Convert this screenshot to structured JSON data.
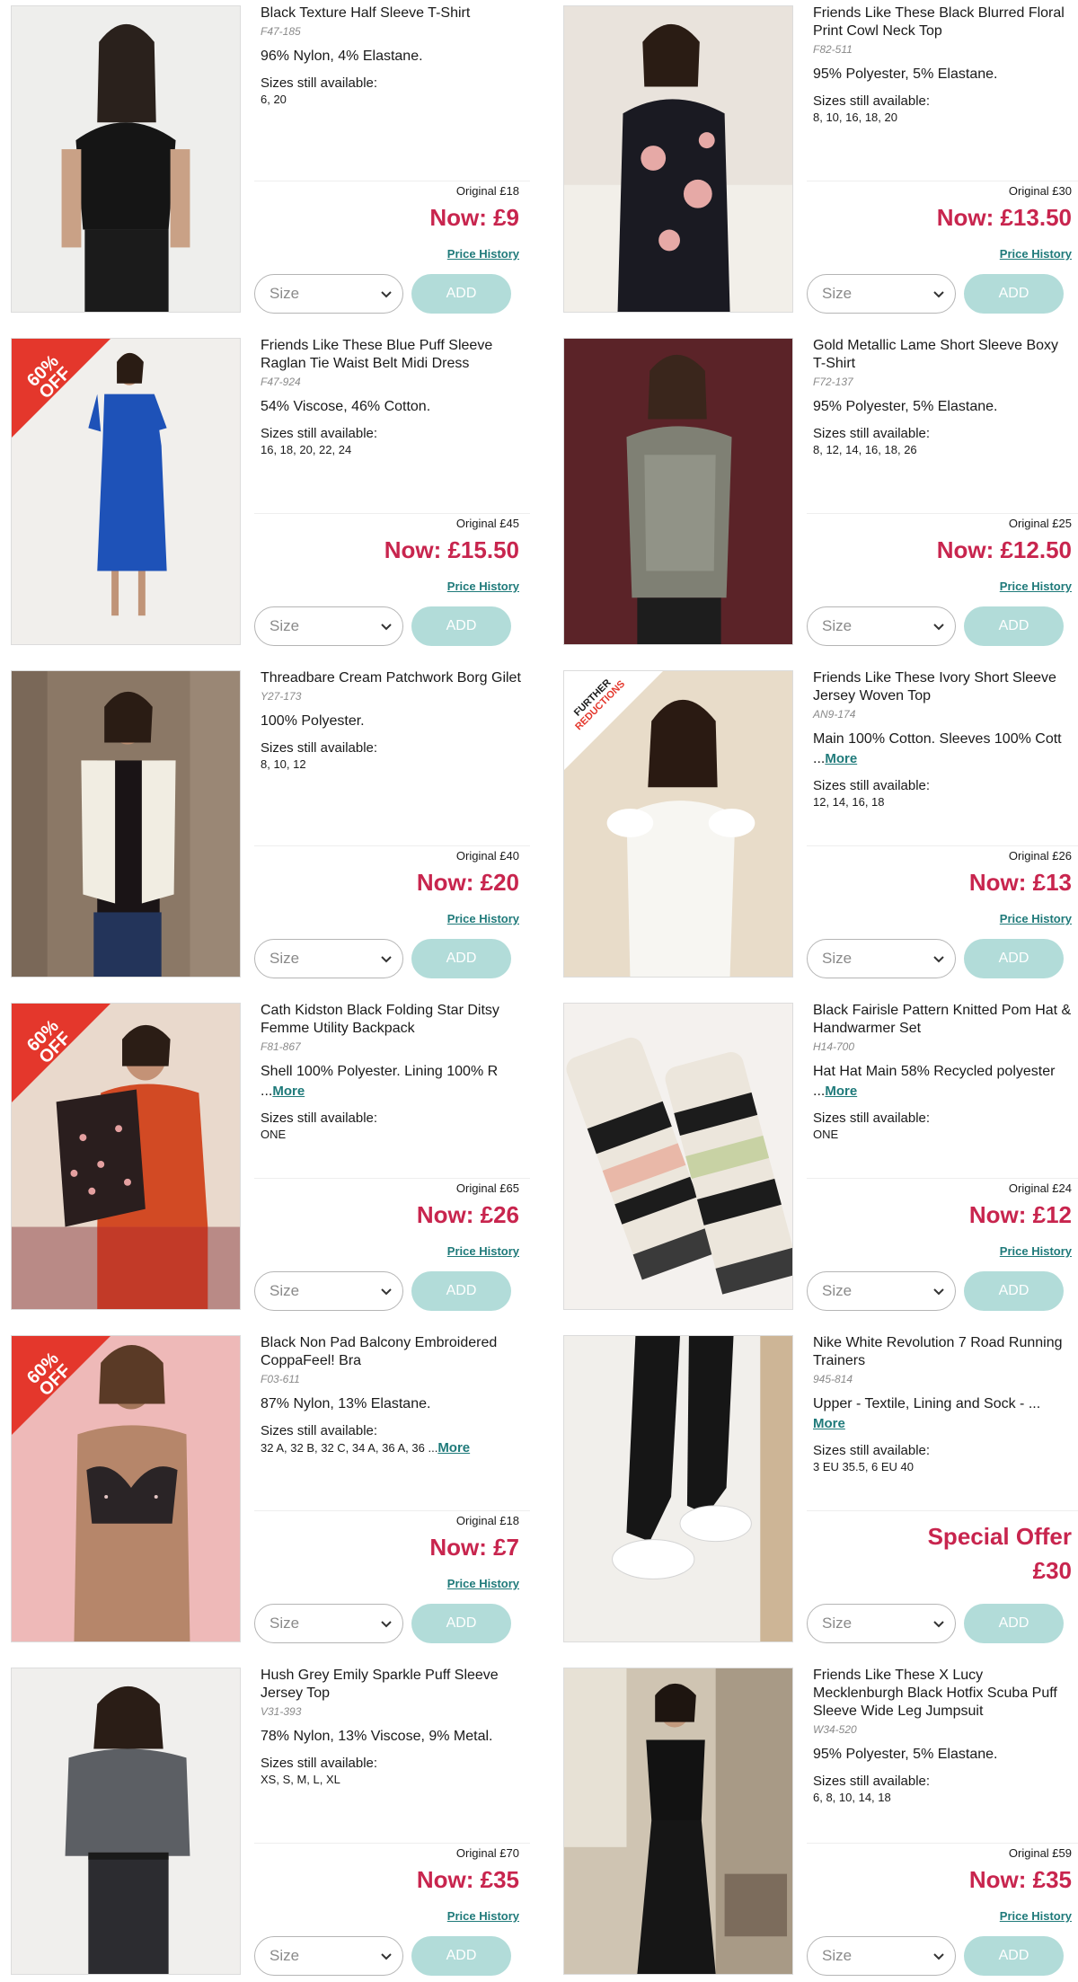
{
  "colors": {
    "price": "#c8254e",
    "link": "#1f7a7a",
    "add_button": "#b2dcd9",
    "badge": "#e4372c"
  },
  "common": {
    "sizes_label": "Sizes still available:",
    "price_history": "Price History",
    "size_placeholder": "Size",
    "add_label": "ADD",
    "more": "More"
  },
  "products": [
    {
      "title": "Black Texture Half Sleeve T-Shirt",
      "code": "F47-185",
      "material": "96% Nylon, 4% Elastane.",
      "sizes": "6, 20",
      "original": "Original £18",
      "now": "Now: £9",
      "badge": ""
    },
    {
      "title": "Friends Like These Black Blurred Floral Print Cowl Neck Top",
      "code": "F82-511",
      "material": "95% Polyester, 5% Elastane.",
      "sizes": "8, 10, 16, 18, 20",
      "original": "Original £30",
      "now": "Now: £13.50",
      "badge": ""
    },
    {
      "title": "Friends Like These Blue Puff Sleeve Raglan Tie Waist Belt Midi Dress",
      "code": "F47-924",
      "material": "54% Viscose, 46% Cotton.",
      "sizes": "16, 18, 20, 22, 24",
      "original": "Original £45",
      "now": "Now: £15.50",
      "badge": "60% OFF"
    },
    {
      "title": "Gold Metallic Lame Short Sleeve Boxy T-Shirt",
      "code": "F72-137",
      "material": "95% Polyester, 5% Elastane.",
      "sizes": "8, 12, 14, 16, 18, 26",
      "original": "Original £25",
      "now": "Now: £12.50",
      "badge": ""
    },
    {
      "title": "Threadbare Cream Patchwork Borg Gilet",
      "code": "Y27-173",
      "material": "100% Polyester.",
      "sizes": "8, 10, 12",
      "original": "Original £40",
      "now": "Now: £20",
      "badge": ""
    },
    {
      "title": "Friends Like These Ivory Short Sleeve Jersey Woven Top",
      "code": "AN9-174",
      "material": "Main 100% Cotton. Sleeves 100% Cott ...",
      "sizes": "12, 14, 16, 18",
      "original": "Original £26",
      "now": "Now: £13",
      "badge": "FURTHER REDUCTIONS"
    },
    {
      "title": "Cath Kidston Black Folding Star Ditsy Femme Utility Backpack",
      "code": "F81-867",
      "material": "Shell 100% Polyester. Lining 100% R ...",
      "sizes": "ONE",
      "original": "Original £65",
      "now": "Now: £26",
      "badge": "60% OFF"
    },
    {
      "title": "Black Fairisle Pattern Knitted Pom Hat & Handwarmer Set",
      "code": "H14-700",
      "material": "Hat Hat Main 58% Recycled polyester ...",
      "sizes": "ONE",
      "original": "Original £24",
      "now": "Now: £12",
      "badge": ""
    },
    {
      "title": "Black Non Pad Balcony Embroidered CoppaFeel! Bra",
      "code": "F03-611",
      "material": "87% Nylon, 13% Elastane.",
      "sizes": "32 A, 32 B, 32 C, 34 A, 36 A, 36 ...",
      "original": "Original £18",
      "now": "Now: £7",
      "badge": "60% OFF"
    },
    {
      "title": "Nike White Revolution 7 Road Running Trainers",
      "code": "945-814",
      "material": "Upper - Textile, Lining and Sock - ...",
      "sizes": "3 EU 35.5, 6 EU 40",
      "special": "Special Offer",
      "special_price": "£30",
      "badge": ""
    },
    {
      "title": "Hush Grey Emily Sparkle Puff Sleeve Jersey Top",
      "code": "V31-393",
      "material": "78% Nylon, 13% Viscose, 9% Metal.",
      "sizes": "XS, S, M, L, XL",
      "original": "Original £70",
      "now": "Now: £35",
      "badge": ""
    },
    {
      "title": "Friends Like These X Lucy Mecklenburgh Black Hotfix Scuba Puff Sleeve Wide Leg Jumpsuit",
      "code": "W34-520",
      "material": "95% Polyester, 5% Elastane.",
      "sizes": "6, 8, 10, 14, 18",
      "original": "Original £59",
      "now": "Now: £35",
      "badge": ""
    }
  ]
}
